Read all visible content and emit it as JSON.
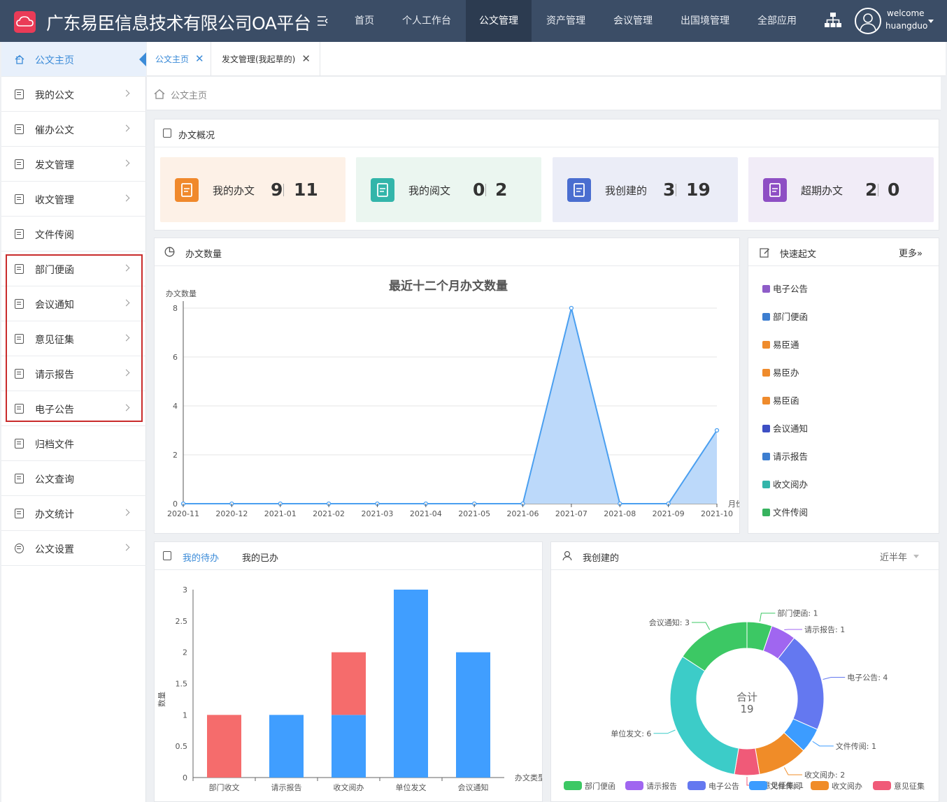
{
  "header": {
    "title": "广东易臣信息技术有限公司OA平台",
    "nav": [
      {
        "label": "首页"
      },
      {
        "label": "个人工作台"
      },
      {
        "label": "公文管理",
        "active": true
      },
      {
        "label": "资产管理"
      },
      {
        "label": "会议管理"
      },
      {
        "label": "出国境管理"
      },
      {
        "label": "全部应用"
      }
    ],
    "welcome": "welcome",
    "username": "huangduo"
  },
  "sidebar": {
    "items": [
      {
        "label": "公文主页",
        "active": true
      },
      {
        "label": "我的公文"
      },
      {
        "label": "催办公文"
      },
      {
        "label": "发文管理"
      },
      {
        "label": "收文管理"
      },
      {
        "label": "文件传阅"
      },
      {
        "label": "部门便函"
      },
      {
        "label": "会议通知"
      },
      {
        "label": "意见征集"
      },
      {
        "label": "请示报告"
      },
      {
        "label": "电子公告"
      },
      {
        "label": "归档文件"
      },
      {
        "label": "公文查询"
      },
      {
        "label": "办文统计"
      },
      {
        "label": "公文设置"
      }
    ]
  },
  "tabs": [
    {
      "label": "公文主页",
      "close": "✕"
    },
    {
      "label": "发文管理(我起草的)",
      "close": "✕"
    }
  ],
  "breadcrumb": "公文主页",
  "overview": {
    "title": "办文概况",
    "cards": [
      {
        "label": "我的办文",
        "a": "9",
        "b": "11",
        "bg": "#fdf1e7",
        "icon": "#f0892c"
      },
      {
        "label": "我的阅文",
        "a": "0",
        "b": "2",
        "bg": "#ebf6f0",
        "icon": "#33b5aa"
      },
      {
        "label": "我创建的",
        "a": "3",
        "b": "19",
        "bg": "#ebedf7",
        "icon": "#4a6ed0"
      },
      {
        "label": "超期办文",
        "a": "2",
        "b": "0",
        "bg": "#f1ecf7",
        "icon": "#8e4fc4"
      }
    ]
  },
  "count_panel": {
    "title": "办文数量"
  },
  "quick": {
    "title": "快速起文",
    "more": "更多»",
    "items": [
      {
        "label": "电子公告",
        "color": "#8e5cc8"
      },
      {
        "label": "部门便函",
        "color": "#3d7ed0"
      },
      {
        "label": "易臣通",
        "color": "#ef8b2c"
      },
      {
        "label": "易臣办",
        "color": "#ef8b2c"
      },
      {
        "label": "易臣函",
        "color": "#ef8b2c"
      },
      {
        "label": "会议通知",
        "color": "#3d4fc4"
      },
      {
        "label": "请示报告",
        "color": "#3d7ed0"
      },
      {
        "label": "收文阅办",
        "color": "#33b5aa"
      },
      {
        "label": "文件传阅",
        "color": "#37b35f"
      }
    ]
  },
  "todo": {
    "tab_active": "我的待办",
    "tab_other": "我的已办"
  },
  "created": {
    "title": "我创建的",
    "filter": "近半年"
  },
  "chart_data": [
    {
      "type": "area",
      "title": "最近十二个月办文数量",
      "ylabel": "办文数量",
      "xlabel": "月份",
      "x": [
        "2020-11",
        "2020-12",
        "2021-01",
        "2021-02",
        "2021-03",
        "2021-04",
        "2021-05",
        "2021-06",
        "2021-07",
        "2021-08",
        "2021-09",
        "2021-10"
      ],
      "values": [
        0,
        0,
        0,
        0,
        0,
        0,
        0,
        0,
        8,
        0,
        0,
        3
      ],
      "yticks": [
        "0",
        "2",
        "4",
        "6",
        "8"
      ],
      "ylim": [
        0,
        8
      ],
      "grid": true,
      "color": "#4a9ff0"
    },
    {
      "type": "bar",
      "ylabel": "数量",
      "xlabel": "办文类型",
      "categories": [
        "部门收文",
        "请示报告",
        "收文阅办",
        "单位发文",
        "会议通知"
      ],
      "series": [
        {
          "values": [
            0,
            1,
            1,
            3,
            2
          ],
          "color": "#409eff"
        },
        {
          "values": [
            1,
            0,
            1,
            0,
            0
          ],
          "color": "#f56c6c"
        }
      ],
      "yticks": [
        "0",
        "0.5",
        "1",
        "1.5",
        "2",
        "2.5",
        "3"
      ],
      "ylim": [
        0,
        3
      ]
    },
    {
      "type": "pie",
      "center_label": "合计",
      "total": "19",
      "slices": [
        {
          "name": "部门便函",
          "value": 1,
          "label": "部门便函: 1",
          "color": "#3cc864"
        },
        {
          "name": "请示报告",
          "value": 1,
          "label": "请示报告: 1",
          "color": "#a066f0"
        },
        {
          "name": "电子公告",
          "value": 4,
          "label": "电子公告: 4",
          "color": "#6478f0"
        },
        {
          "name": "文件传阅",
          "value": 1,
          "label": "文件传阅: 1",
          "color": "#3c9cff"
        },
        {
          "name": "收文阅办",
          "value": 2,
          "label": "收文阅办: 2",
          "color": "#f08c28"
        },
        {
          "name": "意见征集",
          "value": 1,
          "label": "意见征集: 1",
          "color": "#f05a78"
        },
        {
          "name": "单位发文",
          "value": 6,
          "label": "单位发文: 6",
          "color": "#3cccc8"
        },
        {
          "name": "会议通知",
          "value": 3,
          "label": "会议通知: 3",
          "color": "#3cc864"
        }
      ],
      "legend": [
        "部门便函",
        "请示报告",
        "电子公告",
        "文件传阅",
        "收文阅办",
        "意见征集"
      ],
      "legend_placement": "bottom"
    }
  ]
}
